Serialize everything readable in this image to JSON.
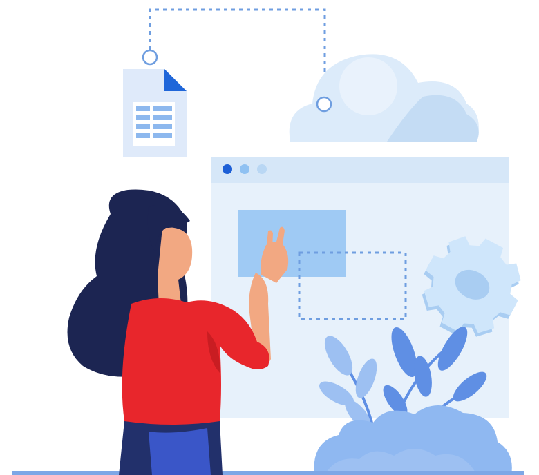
{
  "illustration": {
    "subject": "woman-arranging-browser-window",
    "elements": [
      "document-icon",
      "cloud-icon",
      "browser-window",
      "gear-icon",
      "plant-icon",
      "person"
    ]
  },
  "browser": {
    "dots": [
      "#1d5fd6",
      "#8fc1f2",
      "#b9d7f4"
    ]
  },
  "colors": {
    "window_bg": "#e7f1fb",
    "window_titlebar": "#d6e7f8",
    "panel": "#9fcaf4",
    "dashed_line": "#6f9ee0",
    "cloud": "#dcebfa",
    "cloud_shadow": "#c4dcf4",
    "document": "#dfeafa",
    "document_corner": "#1f66d9",
    "document_lines": "#8db8ee",
    "hair": "#1c2552",
    "skin": "#f2a882",
    "shirt": "#e8262c",
    "shirt_shadow": "#c91d22",
    "pants": "#22306b",
    "pants_highlight": "#3a56c8",
    "gear": "#cfe6fb",
    "gear_shade": "#a9cdf2",
    "leaf_dark": "#5f8fe4",
    "leaf_light": "#9dc0f2",
    "bush": "#8fb8f1",
    "ground": "#7ea7e6"
  }
}
